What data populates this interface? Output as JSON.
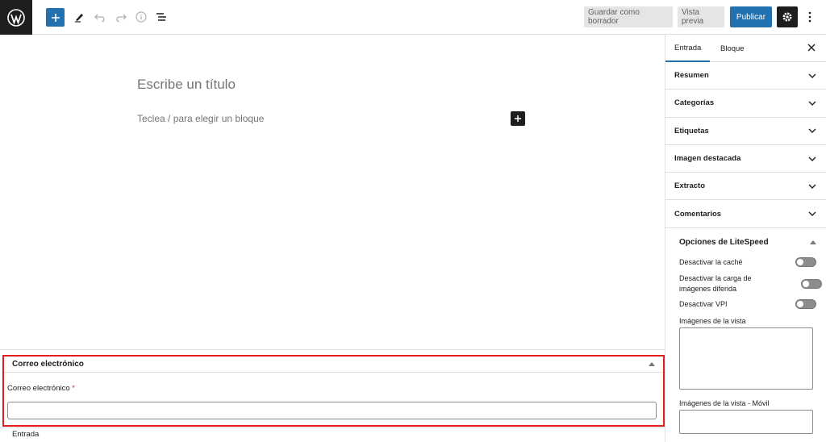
{
  "toolbar": {
    "save_draft": "Guardar como borrador",
    "preview": "Vista previa",
    "publish": "Publicar"
  },
  "editor": {
    "title_placeholder": "Escribe un título",
    "block_hint": "Teclea / para elegir un bloque"
  },
  "sidebar": {
    "tabs": [
      "Entrada",
      "Bloque"
    ],
    "panels": [
      "Resumen",
      "Categorías",
      "Etiquetas",
      "Imagen destacada",
      "Extracto",
      "Comentarios"
    ],
    "litespeed": {
      "title": "Opciones de LiteSpeed",
      "options": [
        "Desactivar la caché",
        "Desactivar la carga de imágenes diferida",
        "Desactivar VPI"
      ],
      "viewport_images_label": "Imágenes de la vista",
      "viewport_images_mobile_label": "Imágenes de la vista - Móvil"
    }
  },
  "meta_box": {
    "title": "Correo electrónico",
    "field_label": "Correo electrónico",
    "required_mark": "*"
  },
  "breadcrumb": "Entrada",
  "colors": {
    "accent": "#2271b1",
    "highlight_border": "#e11d1d",
    "dark": "#1e1e1e"
  }
}
